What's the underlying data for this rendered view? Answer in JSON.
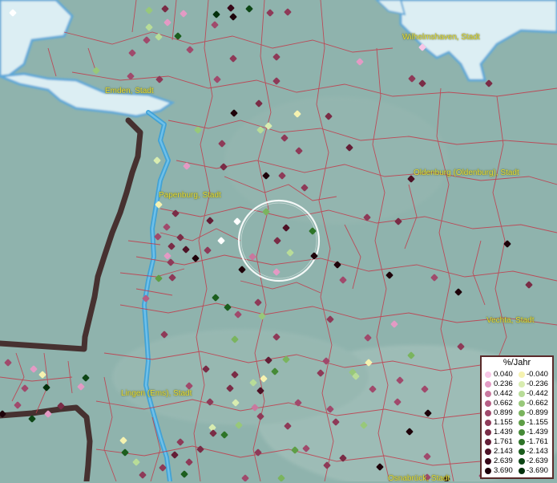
{
  "map": {
    "background_colors": {
      "land": "#8fb3ad",
      "sea": "#dceef3",
      "river": "#3aa0d8",
      "border": "#3a1a1a",
      "district_lines": "#c23a4a"
    },
    "cities": [
      {
        "name": "Wilhelmshaven, Stadt"
      },
      {
        "name": "Emden, Stadt"
      },
      {
        "name": "Oldenburg (Oldenburg), Stadt"
      },
      {
        "name": "Papenburg, Stadt"
      },
      {
        "name": "Vechta, Stadt"
      },
      {
        "name": "Lingen (Ems), Stadt"
      },
      {
        "name": "Osnabrück, Stadt"
      }
    ]
  },
  "legend": {
    "title": "%/Jahr",
    "rows": [
      {
        "pos_label": "0.040",
        "pos_color": "#f7c6e6",
        "neg_label": "-0.040",
        "neg_color": "#f5f2b0"
      },
      {
        "pos_label": "0.236",
        "pos_color": "#e39ac4",
        "neg_label": "-0.236",
        "neg_color": "#d8ecb0"
      },
      {
        "pos_label": "0.442",
        "pos_color": "#c9789e",
        "neg_label": "-0.442",
        "neg_color": "#b8dc98"
      },
      {
        "pos_label": "0.662",
        "pos_color": "#b65e84",
        "neg_label": "-0.662",
        "neg_color": "#98c87a"
      },
      {
        "pos_label": "0.899",
        "pos_color": "#a04a6c",
        "neg_label": "-0.899",
        "neg_color": "#7ab45e"
      },
      {
        "pos_label": "1.155",
        "pos_color": "#8e3a58",
        "neg_label": "-1.155",
        "neg_color": "#5e9e46"
      },
      {
        "pos_label": "1.439",
        "pos_color": "#7a2c46",
        "neg_label": "-1.439",
        "neg_color": "#458a36"
      },
      {
        "pos_label": "1.761",
        "pos_color": "#641e36",
        "neg_label": "-1.761",
        "neg_color": "#2e7428"
      },
      {
        "pos_label": "2.143",
        "pos_color": "#4e1226",
        "neg_label": "-2.143",
        "neg_color": "#1c5e1e"
      },
      {
        "pos_label": "2.639",
        "pos_color": "#380818",
        "neg_label": "-2.639",
        "neg_color": "#0e4616"
      },
      {
        "pos_label": "3.690",
        "pos_color": "#1e020a",
        "neg_label": "-3.690",
        "neg_color": "#04300c"
      }
    ]
  }
}
